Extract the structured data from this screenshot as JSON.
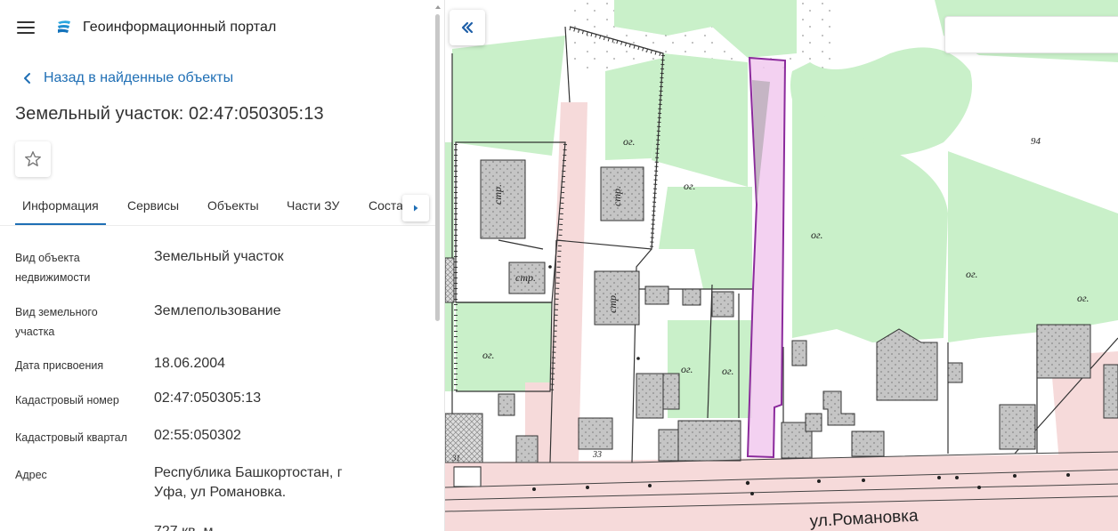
{
  "app": {
    "title": "Геоинформационный портал"
  },
  "nav": {
    "back_label": "Назад в найденные объекты"
  },
  "object": {
    "title": "Земельный участок: 02:47:050305:13"
  },
  "tabs": [
    {
      "label": "Информация",
      "active": true
    },
    {
      "label": "Сервисы",
      "active": false
    },
    {
      "label": "Объекты",
      "active": false
    },
    {
      "label": "Части ЗУ",
      "active": false
    },
    {
      "label": "Соста",
      "active": false
    }
  ],
  "info_rows": [
    {
      "label": "Вид объекта недвижимости",
      "value": "Земельный участок"
    },
    {
      "label": "Вид земельного участка",
      "value": "Землепользование"
    },
    {
      "label": "Дата присвоения",
      "value": "18.06.2004"
    },
    {
      "label": "Кадастровый номер",
      "value": "02:47:050305:13"
    },
    {
      "label": "Кадастровый квартал",
      "value": "02:55:050302"
    },
    {
      "label": "Адрес",
      "value": "Республика Башкортостан, г Уфа, ул Романовка."
    },
    {
      "label": "",
      "value": "727 кв. м"
    }
  ],
  "map": {
    "labels": {
      "og": "ог.",
      "str": "стр.",
      "street": "ул.Романовка",
      "num94": "94",
      "num33": "33",
      "num31": "31"
    },
    "colors": {
      "green": "#c9f0c9",
      "pink": "#f6dada",
      "building": "#bdbdbd",
      "highlight_fill": "#f1c9ee",
      "highlight_stroke": "#8b2a9c"
    }
  },
  "icons": {
    "menu": "hamburger-icon",
    "logo": "portal-logo-icon",
    "back": "chevron-left-icon",
    "favorite": "star-outline-icon",
    "tab_next": "caret-right-icon",
    "collapse": "double-chevron-left-icon"
  },
  "theme": {
    "accent": "#1f6fb5"
  }
}
